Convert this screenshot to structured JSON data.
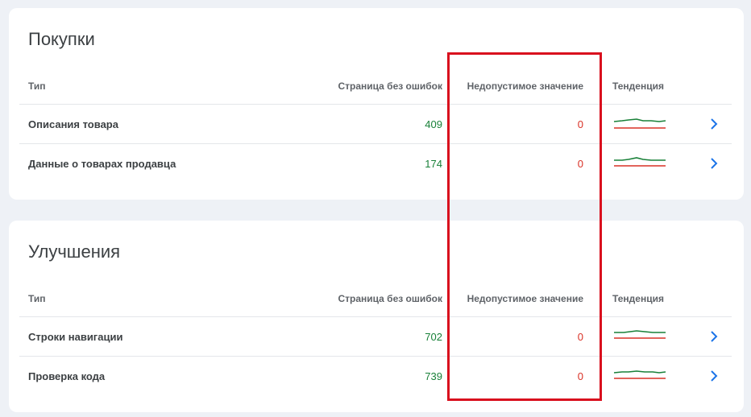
{
  "cards": [
    {
      "title": "Покупки",
      "headers": {
        "type": "Тип",
        "valid": "Страница без ошибок",
        "invalid": "Недопустимое значение",
        "trend": "Тенденция"
      },
      "rows": [
        {
          "type": "Описания товара",
          "valid": "409",
          "invalid": "0"
        },
        {
          "type": "Данные о товарах продавца",
          "valid": "174",
          "invalid": "0"
        }
      ]
    },
    {
      "title": "Улучшения",
      "headers": {
        "type": "Тип",
        "valid": "Страница без ошибок",
        "invalid": "Недопустимое значение",
        "trend": "Тенденция"
      },
      "rows": [
        {
          "type": "Строки навигации",
          "valid": "702",
          "invalid": "0"
        },
        {
          "type": "Проверка кода",
          "valid": "739",
          "invalid": "0"
        }
      ]
    }
  ],
  "colors": {
    "valid": "#188038",
    "invalid": "#d93025",
    "highlight": "#d9101e",
    "arrow": "#1a73e8"
  },
  "icons": {
    "row_arrow": "chevron-right-icon",
    "trend": "sparkline-icon"
  }
}
